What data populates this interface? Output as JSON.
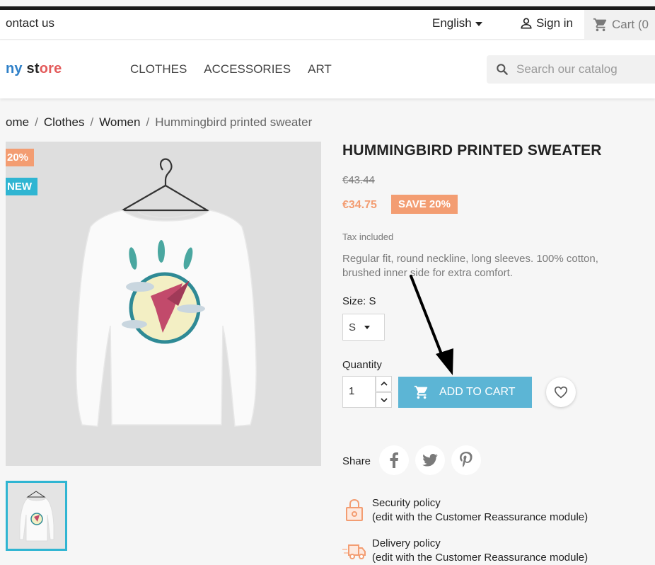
{
  "topnav": {
    "contact": "ontact us",
    "language": "English",
    "signin": "Sign in",
    "cart": "Cart (0"
  },
  "header": {
    "logo_part1": "ny",
    "logo_part2": " st",
    "logo_part3": "ore",
    "menu": [
      "CLOTHES",
      "ACCESSORIES",
      "ART"
    ],
    "search_placeholder": "Search our catalog"
  },
  "breadcrumb": {
    "items": [
      "ome",
      "Clothes",
      "Women"
    ],
    "current": "Hummingbird printed sweater",
    "separator": "/"
  },
  "product": {
    "flags": {
      "discount": "20%",
      "new": "NEW"
    },
    "title": "HUMMINGBIRD PRINTED SWEATER",
    "regular_price": "€43.44",
    "price": "€34.75",
    "save_badge": "SAVE 20%",
    "tax_label": "Tax included",
    "description": "Regular fit, round neckline, long sleeves. 100% cotton, brushed inner side for extra comfort.",
    "size_label": "Size: S",
    "size_selected": "S",
    "quantity_label": "Quantity",
    "quantity_value": "1",
    "add_to_cart": "ADD TO CART",
    "share_label": "Share"
  },
  "reassurance": [
    {
      "title": "Security policy",
      "subtitle": "(edit with the Customer Reassurance module)"
    },
    {
      "title": "Delivery policy",
      "subtitle": "(edit with the Customer Reassurance module)"
    }
  ],
  "colors": {
    "accent": "#2fb5d2",
    "discount": "#f39d72",
    "button": "#5cb5d5"
  }
}
